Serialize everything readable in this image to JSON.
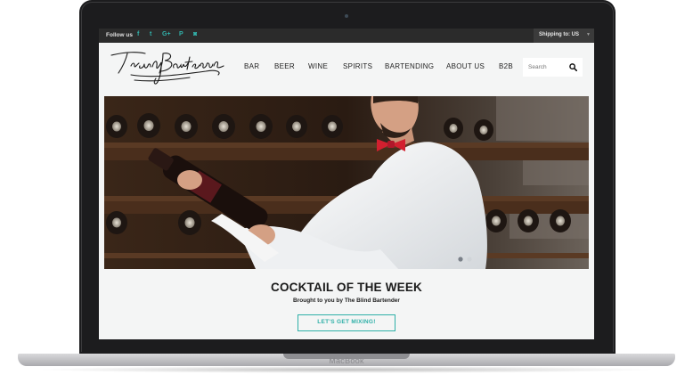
{
  "device": {
    "brand_label": "MacBook"
  },
  "topbar": {
    "follow_label": "Follow us",
    "social_icons": [
      "facebook-icon",
      "twitter-icon",
      "google-plus-icon",
      "pinterest-icon",
      "instagram-icon"
    ],
    "social_glyphs": {
      "facebook": "f",
      "twitter": "t",
      "google_plus": "G+",
      "pinterest": "P",
      "instagram": "◙"
    },
    "shipping_label": "Shipping to: US"
  },
  "header": {
    "logo_text": "Trendy Bartender",
    "nav": [
      "BAR",
      "BEER",
      "WINE",
      "SPIRITS",
      "BARTENDING",
      "ABOUT US",
      "B2B"
    ],
    "search": {
      "placeholder": "Search"
    }
  },
  "hero": {
    "description": "Sommelier in white shirt and red bow tie reading a wine label in a cellar",
    "carousel_dots": 2,
    "active_dot": 1
  },
  "feature": {
    "headline": "COCKTAIL OF THE WEEK",
    "subline": "Brought to you by The Blind Bartender",
    "cta_label": "LET'S GET MIXING!"
  },
  "colors": {
    "accent": "#2fb0a8",
    "topbar": "#2b2b2b",
    "page_bg": "#f4f5f5",
    "bow_tie": "#d2202f"
  }
}
